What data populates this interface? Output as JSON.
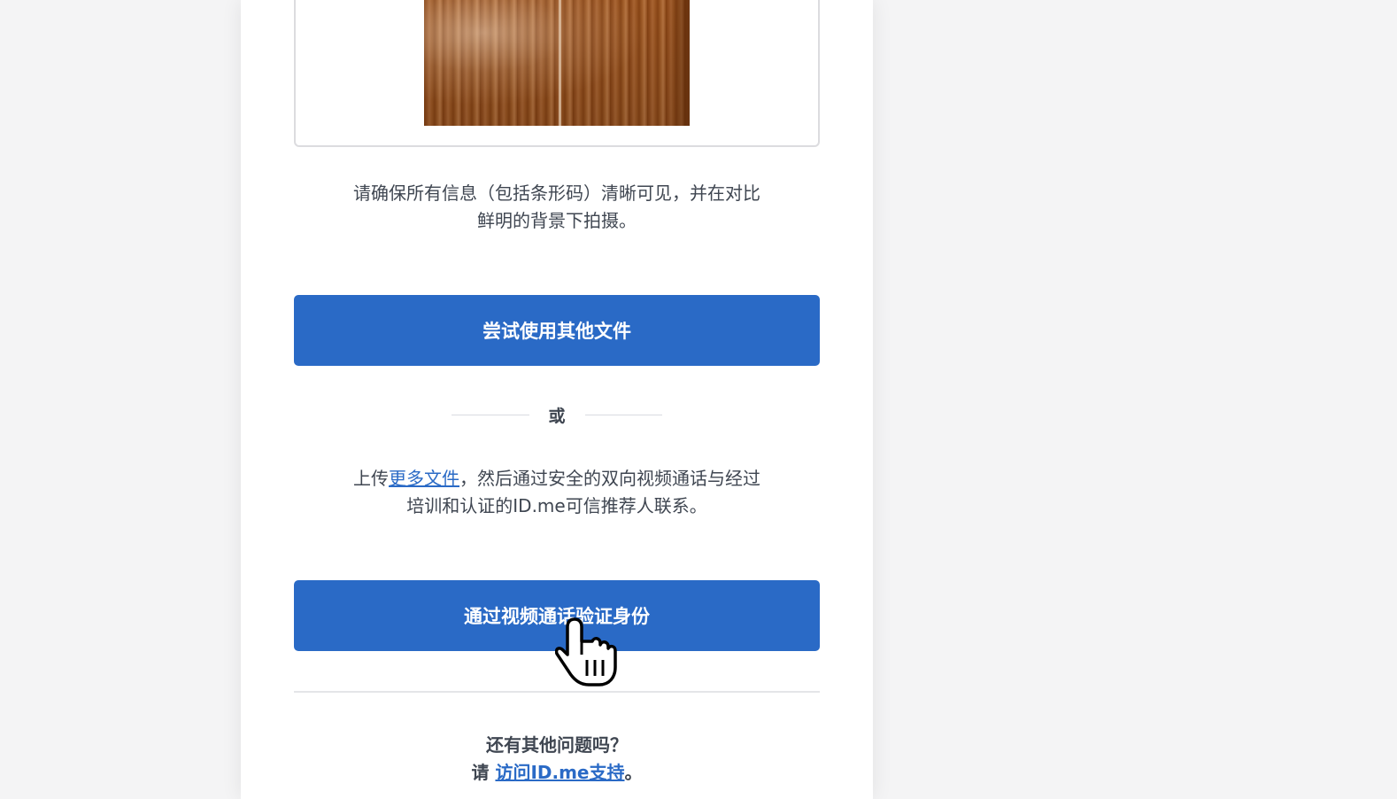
{
  "document_preview": {
    "alt": "uploaded-document-photo"
  },
  "instructions": {
    "line1": "请确保所有信息（包括条形码）清晰可见，并在对比",
    "line2": "鲜明的背景下拍摄。"
  },
  "primary_button": {
    "label": "尝试使用其他文件"
  },
  "divider": {
    "label": "或"
  },
  "alternative": {
    "prefix": "上传",
    "link_text": "更多文件",
    "suffix_line1": "，然后通过安全的双向视频通话与经过",
    "line2": "培训和认证的ID.me可信推荐人联系。"
  },
  "video_button": {
    "label": "通过视频通话验证身份"
  },
  "help": {
    "question": "还有其他问题吗？",
    "prefix": "请 ",
    "link_text": "访问ID.me支持",
    "suffix": "。"
  },
  "colors": {
    "primary": "#2a6ac6",
    "text": "#3f4651",
    "background": "#f4f4f5"
  },
  "cursor": {
    "icon": "hand-pointer-icon"
  }
}
